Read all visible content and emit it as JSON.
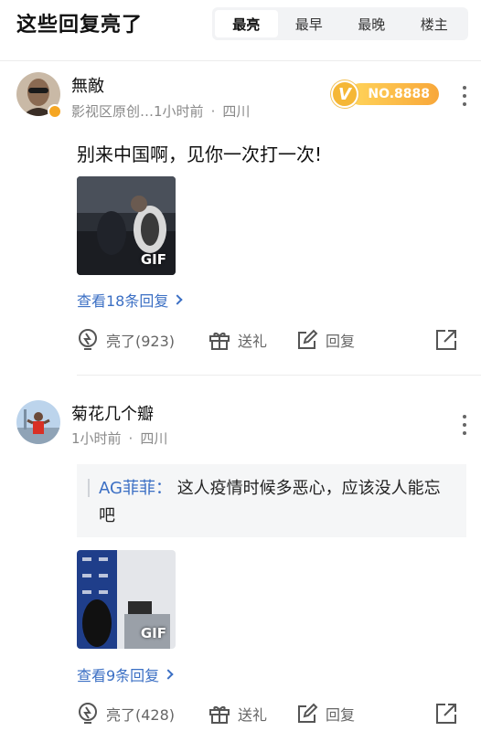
{
  "header": {
    "title": "这些回复亮了",
    "tabs": [
      {
        "label": "最亮",
        "active": true
      },
      {
        "label": "最早",
        "active": false
      },
      {
        "label": "最晚",
        "active": false
      },
      {
        "label": "楼主",
        "active": false
      }
    ]
  },
  "comments": [
    {
      "username": "無敵",
      "meta": {
        "label": "影视区原创…",
        "time": "1小时前",
        "dot": "·",
        "location": "四川"
      },
      "badge": {
        "text": "NO.8888",
        "icon": "V"
      },
      "text": "别来中国啊，见你一次打一次!",
      "gif_label": "GIF",
      "replies_label": "查看18条回复",
      "actions": {
        "light": "亮了(923)",
        "gift": "送礼",
        "reply": "回复"
      }
    },
    {
      "username": "菊花几个瓣",
      "meta": {
        "time": "1小时前",
        "dot": "·",
        "location": "四川"
      },
      "quote": {
        "name": "AG菲菲：",
        "text": "这人疫情时候多恶心，应该没人能忘吧"
      },
      "gif_label": "GIF",
      "replies_label": "查看9条回复",
      "actions": {
        "light": "亮了(428)",
        "gift": "送礼",
        "reply": "回复"
      }
    }
  ],
  "colors": {
    "link": "#3b6fc4",
    "badge_gold": "#f8a73a",
    "muted": "#8a8a8a"
  },
  "icons": [
    "lightbulb-icon",
    "gift-icon",
    "edit-icon",
    "share-icon",
    "more-icon",
    "vip-badge-icon"
  ]
}
